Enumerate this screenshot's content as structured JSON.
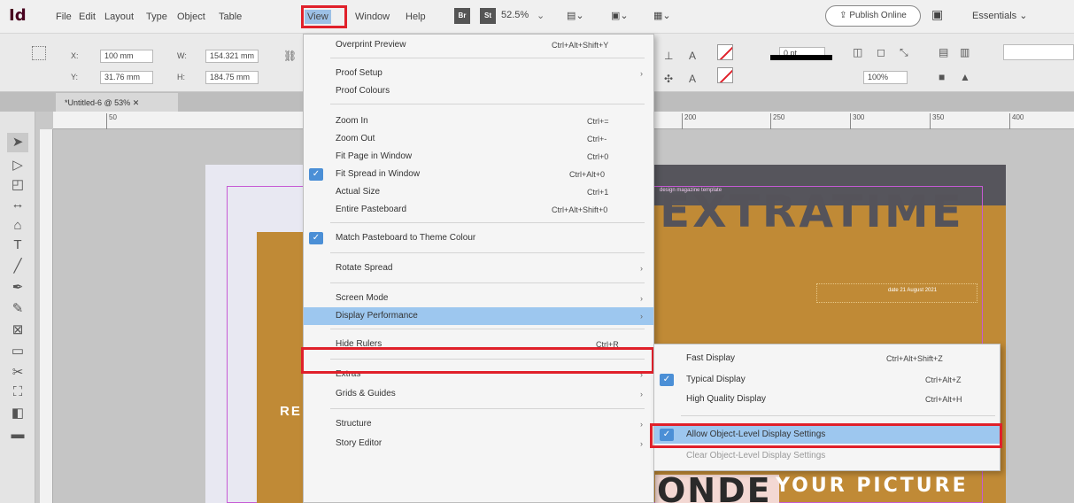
{
  "menubar": {
    "app_logo": "Id",
    "items": [
      "File",
      "Edit",
      "Layout",
      "Type",
      "Object",
      "Table",
      "View",
      "Window",
      "Help"
    ],
    "br_label": "Br",
    "st_label": "St",
    "zoom": "52.5%",
    "publish_online": "Publish Online",
    "workspace": "Essentials"
  },
  "control_panel": {
    "x_label": "X:",
    "x_value": "100 mm",
    "y_label": "Y:",
    "y_value": "31.76 mm",
    "w_label": "W:",
    "w_value": "154.321 mm",
    "h_label": "H:",
    "h_value": "184.75 mm",
    "stroke_weight": "0 pt",
    "opacity": "100%"
  },
  "document": {
    "tab_title": "*Untitled-6 @ 53%",
    "ruler_ticks": [
      "50",
      "200",
      "250",
      "300",
      "350",
      "400"
    ],
    "left_text": "RE",
    "kicker": "design magazine template",
    "headline": "EXTRATIME",
    "date": "date 21 August 2021",
    "bottom_a": "ONDE",
    "bottom_b": "YOUR PICTURE"
  },
  "view_menu": {
    "items": [
      {
        "label": "Overprint Preview",
        "shortcut": "Ctrl+Alt+Shift+Y"
      },
      {
        "label": "Proof Setup",
        "submenu": true
      },
      {
        "label": "Proof Colours"
      },
      {
        "label": "Zoom In",
        "shortcut": "Ctrl+="
      },
      {
        "label": "Zoom Out",
        "shortcut": "Ctrl+-"
      },
      {
        "label": "Fit Page in Window",
        "shortcut": "Ctrl+0"
      },
      {
        "label": "Fit Spread in Window",
        "shortcut": "Ctrl+Alt+0",
        "checked": true
      },
      {
        "label": "Actual Size",
        "shortcut": "Ctrl+1"
      },
      {
        "label": "Entire Pasteboard",
        "shortcut": "Ctrl+Alt+Shift+0"
      },
      {
        "label": "Match Pasteboard to Theme Colour",
        "checked": true
      },
      {
        "label": "Rotate Spread",
        "submenu": true
      },
      {
        "label": "Screen Mode",
        "submenu": true
      },
      {
        "label": "Display Performance",
        "submenu": true,
        "selected": true
      },
      {
        "label": "Hide Rulers",
        "shortcut": "Ctrl+R"
      },
      {
        "label": "Extras",
        "submenu": true
      },
      {
        "label": "Grids & Guides",
        "submenu": true
      },
      {
        "label": "Structure",
        "submenu": true
      },
      {
        "label": "Story Editor",
        "submenu": true
      }
    ]
  },
  "display_performance_menu": {
    "items": [
      {
        "label": "Fast Display",
        "shortcut": "Ctrl+Alt+Shift+Z"
      },
      {
        "label": "Typical Display",
        "shortcut": "Ctrl+Alt+Z",
        "checked": true
      },
      {
        "label": "High Quality Display",
        "shortcut": "Ctrl+Alt+H"
      },
      {
        "label": "Allow Object-Level Display Settings",
        "checked": true,
        "selected": true
      },
      {
        "label": "Clear Object-Level Display Settings",
        "disabled": true
      }
    ]
  },
  "colors": {
    "highlight_box": "#e0202a",
    "menu_selection": "#9dc7ef",
    "check_blue": "#4b8fd6",
    "page_gold": "#c08a36"
  }
}
